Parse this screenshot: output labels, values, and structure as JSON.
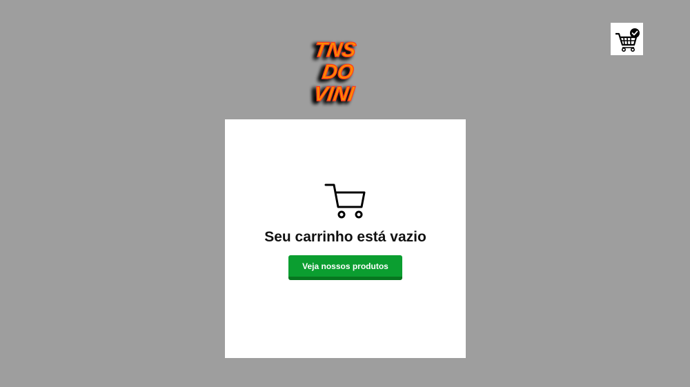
{
  "header": {
    "logo_lines": [
      "TNS",
      "DO",
      "VINI"
    ],
    "logo_color": "#ff8a00",
    "logo_outline_color": "#ff3b1f",
    "cart_status_icon": "cart-check-icon"
  },
  "main": {
    "empty_icon": "shopping-cart-icon",
    "empty_message": "Seu carrinho está vazio",
    "cta_label": "Veja nossos produtos",
    "cta_color": "#0b9e30"
  },
  "colors": {
    "background": "#9e9e9e",
    "panel": "#ffffff"
  }
}
